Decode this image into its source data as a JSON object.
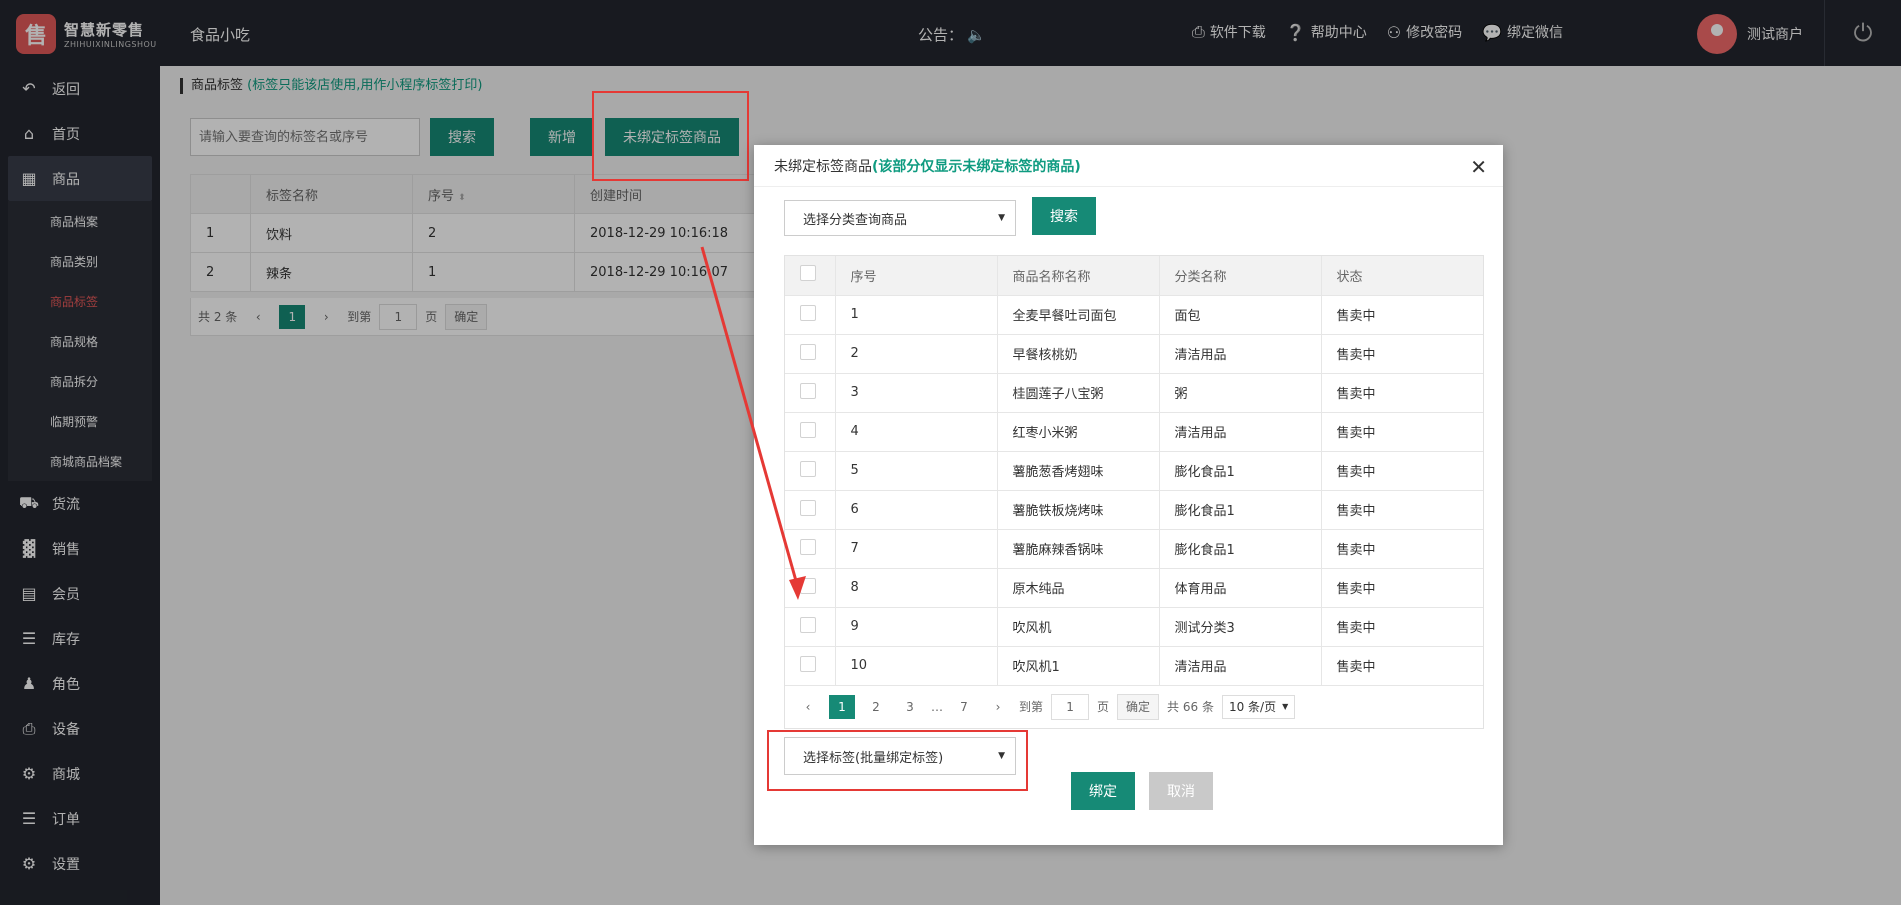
{
  "brand": {
    "logo_glyph": "售",
    "name_cn": "智慧新零售",
    "name_en": "ZHIHUIXINLINGSHOU"
  },
  "header": {
    "shop_name": "食品小吃",
    "notice_label": "公告：",
    "links": [
      {
        "icon": "printer-icon",
        "label": "软件下载"
      },
      {
        "icon": "help-icon",
        "label": "帮助中心"
      },
      {
        "icon": "key-icon",
        "label": "修改密码"
      },
      {
        "icon": "wechat-icon",
        "label": "绑定微信"
      }
    ],
    "user_name": "测试商户"
  },
  "sidebar": {
    "items": [
      {
        "label": "返回",
        "icon": "back-icon"
      },
      {
        "label": "首页",
        "icon": "home-icon"
      },
      {
        "label": "商品",
        "icon": "table-icon"
      },
      {
        "label": "货流",
        "icon": "truck-icon"
      },
      {
        "label": "销售",
        "icon": "bar-chart-icon"
      },
      {
        "label": "会员",
        "icon": "id-card-icon"
      },
      {
        "label": "库存",
        "icon": "database-icon"
      },
      {
        "label": "角色",
        "icon": "user-icon"
      },
      {
        "label": "设备",
        "icon": "printer-icon"
      },
      {
        "label": "商城",
        "icon": "gear-icon"
      },
      {
        "label": "订单",
        "icon": "list-icon"
      },
      {
        "label": "设置",
        "icon": "gear-icon"
      }
    ],
    "sub_items": [
      "商品档案",
      "商品类别",
      "商品标签",
      "商品规格",
      "商品拆分",
      "临期预警",
      "商城商品档案"
    ]
  },
  "page": {
    "title": "商品标签",
    "hint": "(标签只能该店使用,用作小程序标签打印)",
    "search_placeholder": "请输入要查询的标签名或序号",
    "search_button": "搜索",
    "add_button": "新增",
    "unbound_button": "未绑定标签商品",
    "table": {
      "headers": [
        "",
        "标签名称",
        "序号",
        "创建时间"
      ],
      "rows": [
        [
          "1",
          "饮料",
          "2",
          "2018-12-29 10:16:18"
        ],
        [
          "2",
          "辣条",
          "1",
          "2018-12-29 10:16:07"
        ]
      ]
    },
    "pager": {
      "total": "共 2 条",
      "current": "1",
      "goto_label": "到第",
      "goto_value": "1",
      "page_unit": "页",
      "confirm": "确定"
    }
  },
  "modal": {
    "title": "未绑定标签商品",
    "title_hint": "(该部分仅显示未绑定标签的商品)",
    "category_select": "选择分类查询商品",
    "search_button": "搜索",
    "headers": [
      "序号",
      "商品名称名称",
      "分类名称",
      "状态"
    ],
    "rows": [
      [
        "1",
        "全麦早餐吐司面包",
        "面包",
        "售卖中"
      ],
      [
        "2",
        "早餐核桃奶",
        "清洁用品",
        "售卖中"
      ],
      [
        "3",
        "桂圆莲子八宝粥",
        "粥",
        "售卖中"
      ],
      [
        "4",
        "红枣小米粥",
        "清洁用品",
        "售卖中"
      ],
      [
        "5",
        "薯脆葱香烤翅味",
        "膨化食品1",
        "售卖中"
      ],
      [
        "6",
        "薯脆铁板烧烤味",
        "膨化食品1",
        "售卖中"
      ],
      [
        "7",
        "薯脆麻辣香锅味",
        "膨化食品1",
        "售卖中"
      ],
      [
        "8",
        "原木纯品",
        "体育用品",
        "售卖中"
      ],
      [
        "9",
        "吹风机",
        "测试分类3",
        "售卖中"
      ],
      [
        "10",
        "吹风机1",
        "清洁用品",
        "售卖中"
      ]
    ],
    "pager": {
      "pages": [
        "1",
        "2",
        "3",
        "…",
        "7"
      ],
      "goto_label": "到第",
      "goto_value": "1",
      "page_unit": "页",
      "confirm": "确定",
      "total": "共 66 条",
      "per_page": "10 条/页"
    },
    "tag_select": "选择标签(批量绑定标签)",
    "bind_button": "绑定",
    "cancel_button": "取消"
  },
  "colors": {
    "primary": "#168a76",
    "sidebar": "#23262e",
    "annotation": "#e53935",
    "accent_text": "#0f9b80",
    "active_sub": "#e85a5a"
  }
}
